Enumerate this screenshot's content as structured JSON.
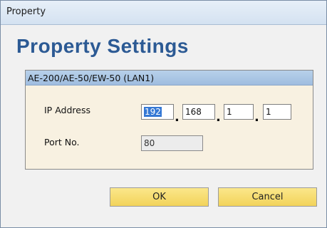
{
  "window": {
    "title": "Property"
  },
  "heading": "Property Settings",
  "group": {
    "title": "AE-200/AE-50/EW-50 (LAN1)",
    "ip_label": "IP Address",
    "ip_octets": [
      "192",
      "168",
      "1",
      "1"
    ],
    "ip_separator": ".",
    "port_label": "Port No.",
    "port_value": "80"
  },
  "buttons": {
    "ok": "OK",
    "cancel": "Cancel"
  },
  "colors": {
    "heading": "#2c5a94",
    "group_header": "#b7d0ea",
    "group_body": "#f8f1e1",
    "button": "#f2d35a",
    "selection": "#3578d4"
  }
}
